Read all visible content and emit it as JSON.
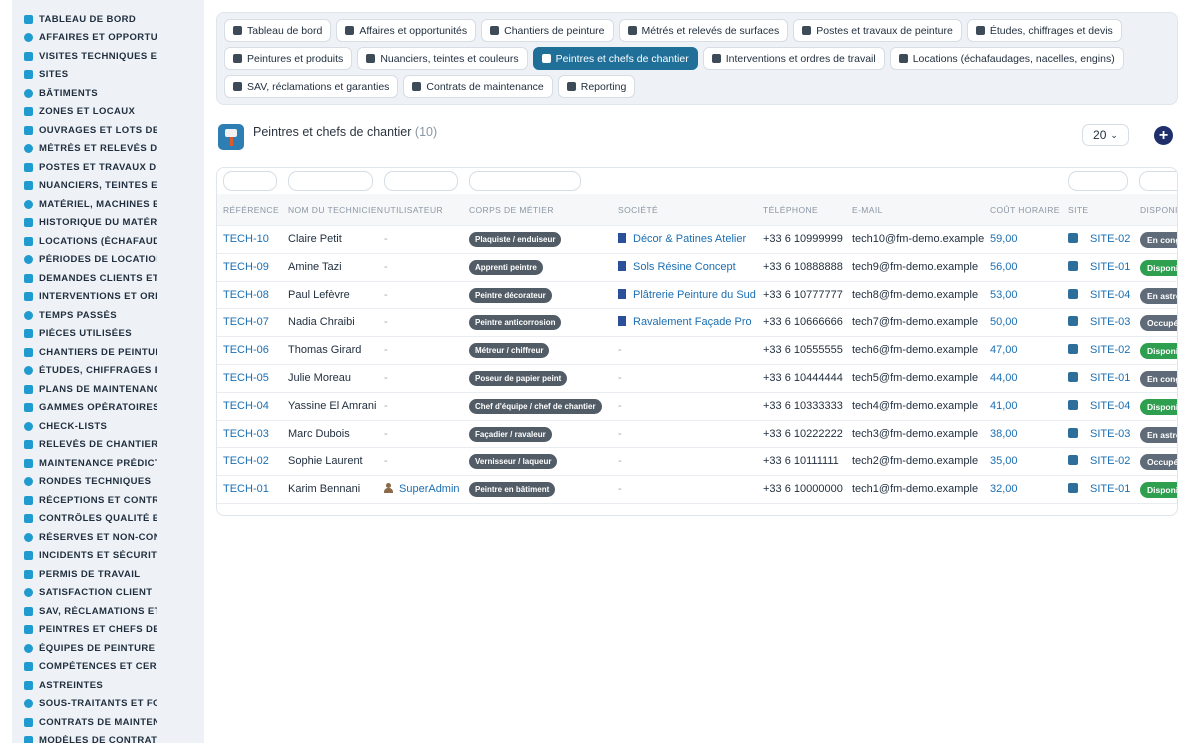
{
  "sidebar": {
    "items": [
      {
        "label": "TABLEAU DE BORD",
        "icon": "dashboard-icon"
      },
      {
        "label": "AFFAIRES ET OPPORTUNITÉS",
        "icon": "target-icon"
      },
      {
        "label": "VISITES TECHNIQUES ET AUDITS",
        "icon": "clipboard-icon"
      },
      {
        "label": "SITES",
        "icon": "location-pin-icon"
      },
      {
        "label": "BÂTIMENTS",
        "icon": "building-icon"
      },
      {
        "label": "ZONES ET LOCAUX",
        "icon": "map-icon"
      },
      {
        "label": "OUVRAGES ET LOTS DE TRAVAUX",
        "icon": "sitemap-icon"
      },
      {
        "label": "MÉTRÉS ET RELEVÉS DE SURFACES",
        "icon": "ruler-icon"
      },
      {
        "label": "POSTES ET TRAVAUX DE PEINTURE",
        "icon": "paint-roller-icon"
      },
      {
        "label": "NUANCIERS, TEINTES ET COULEURS",
        "icon": "palette-icon"
      },
      {
        "label": "MATÉRIEL, MACHINES ET OUTILLAGE",
        "icon": "tools-icon"
      },
      {
        "label": "HISTORIQUE DU MATÉRIEL",
        "icon": "history-icon"
      },
      {
        "label": "LOCATIONS (ÉCHAFAUDAGES)",
        "icon": "truck-icon"
      },
      {
        "label": "PÉRIODES DE LOCATION",
        "icon": "calendar-icon"
      },
      {
        "label": "DEMANDES CLIENTS ET INTERVENTIONS",
        "icon": "inbox-icon"
      },
      {
        "label": "INTERVENTIONS ET ORDRES DE TRAVAIL",
        "icon": "clipboard-check-icon"
      },
      {
        "label": "TEMPS PASSÉS",
        "icon": "clock-icon"
      },
      {
        "label": "PIÈCES UTILISÉES",
        "icon": "box-icon"
      },
      {
        "label": "CHANTIERS DE PEINTURE",
        "icon": "brush-icon"
      },
      {
        "label": "ÉTUDES, CHIFFRAGES ET DEVIS",
        "icon": "calculator-icon"
      },
      {
        "label": "PLANS DE MAINTENANCE",
        "icon": "calendar-check-icon"
      },
      {
        "label": "GAMMES OPÉRATOIRES",
        "icon": "list-icon"
      },
      {
        "label": "CHECK-LISTS",
        "icon": "checklist-icon"
      },
      {
        "label": "RELEVÉS DE CHANTIER",
        "icon": "file-icon"
      },
      {
        "label": "MAINTENANCE PRÉDICTIVE",
        "icon": "chart-line-icon"
      },
      {
        "label": "RONDES TECHNIQUES",
        "icon": "route-icon"
      },
      {
        "label": "RÉCEPTIONS ET CONTRÔLES",
        "icon": "search-icon"
      },
      {
        "label": "CONTRÔLES QUALITÉ ET CONFORMITÉ",
        "icon": "shield-check-icon"
      },
      {
        "label": "RÉSERVES ET NON-CONFORMITÉS",
        "icon": "alert-circle-icon"
      },
      {
        "label": "INCIDENTS ET SÉCURITÉ",
        "icon": "warning-icon"
      },
      {
        "label": "PERMIS DE TRAVAIL",
        "icon": "document-sign-icon"
      },
      {
        "label": "SATISFACTION CLIENT",
        "icon": "smile-icon"
      },
      {
        "label": "SAV, RÉCLAMATIONS ET GARANTIES",
        "icon": "chat-icon"
      },
      {
        "label": "PEINTRES ET CHEFS DE CHANTIER",
        "icon": "hard-hat-icon"
      },
      {
        "label": "ÉQUIPES DE PEINTURE",
        "icon": "users-icon"
      },
      {
        "label": "COMPÉTENCES ET CERTIFICATIONS",
        "icon": "badge-icon"
      },
      {
        "label": "ASTREINTES",
        "icon": "phone-icon"
      },
      {
        "label": "SOUS-TRAITANTS ET FOURNISSEURS",
        "icon": "handshake-icon"
      },
      {
        "label": "CONTRATS DE MAINTENANCE",
        "icon": "contract-icon"
      },
      {
        "label": "MODÈLES DE CONTRATS",
        "icon": "template-icon"
      }
    ]
  },
  "modules": {
    "rows": [
      [
        {
          "label": "Tableau de bord",
          "icon": "dashboard-icon",
          "active": false
        },
        {
          "label": "Affaires et opportunités",
          "icon": "target-icon",
          "active": false
        },
        {
          "label": "Chantiers de peinture",
          "icon": "brush-icon",
          "active": false
        },
        {
          "label": "Métrés et relevés de surfaces",
          "icon": "ruler-icon",
          "active": false
        },
        {
          "label": "Postes et travaux de peinture",
          "icon": "paint-roller-icon",
          "active": false
        },
        {
          "label": "Études, chiffrages et devis",
          "icon": "calculator-icon",
          "active": false
        }
      ],
      [
        {
          "label": "Peintures et produits",
          "icon": "paint-bucket-icon",
          "active": false
        },
        {
          "label": "Nuanciers, teintes et couleurs",
          "icon": "palette-icon",
          "active": false
        },
        {
          "label": "Peintres et chefs de chantier",
          "icon": "hard-hat-icon",
          "active": true
        },
        {
          "label": "Interventions et ordres de travail",
          "icon": "clipboard-check-icon",
          "active": false
        },
        {
          "label": "Locations (échafaudages, nacelles, engins)",
          "icon": "truck-icon",
          "active": false
        }
      ],
      [
        {
          "label": "SAV, réclamations et garanties",
          "icon": "chat-icon",
          "active": false
        },
        {
          "label": "Contrats de maintenance",
          "icon": "contract-icon",
          "active": false
        },
        {
          "label": "Reporting",
          "icon": "pie-chart-icon",
          "active": false
        }
      ]
    ]
  },
  "page": {
    "title": "Peintres et chefs de chantier",
    "count": "(10)",
    "per_page": "20",
    "add_label": "+"
  },
  "table": {
    "headers": [
      "RÉFÉRENCE",
      "NOM DU TECHNICIEN",
      "UTILISATEUR",
      "CORPS DE MÉTIER",
      "SOCIÉTÉ",
      "TÉLÉPHONE",
      "E-MAIL",
      "COÛT HORAIRE",
      "SITE",
      "DISPONIBILITÉ"
    ],
    "rows": [
      {
        "ref": "TECH-10",
        "name": "Claire Petit",
        "user": "-",
        "trade": "Plaquiste / enduiseur",
        "company": "Décor & Patines Atelier",
        "phone": "+33 6 10999999",
        "email": "tech10@fm-demo.example",
        "rate": "59,00",
        "site": "SITE-02",
        "status": "En congé",
        "status_color": "#5f6b78"
      },
      {
        "ref": "TECH-09",
        "name": "Amine Tazi",
        "user": "-",
        "trade": "Apprenti peintre",
        "company": "Sols Résine Concept",
        "phone": "+33 6 10888888",
        "email": "tech9@fm-demo.example",
        "rate": "56,00",
        "site": "SITE-01",
        "status": "Disponible",
        "status_color": "#2e9e4f"
      },
      {
        "ref": "TECH-08",
        "name": "Paul Lefèvre",
        "user": "-",
        "trade": "Peintre décorateur",
        "company": "Plâtrerie Peinture du Sud",
        "phone": "+33 6 10777777",
        "email": "tech8@fm-demo.example",
        "rate": "53,00",
        "site": "SITE-04",
        "status": "En astreinte",
        "status_color": "#5f6b78"
      },
      {
        "ref": "TECH-07",
        "name": "Nadia Chraibi",
        "user": "-",
        "trade": "Peintre anticorrosion",
        "company": "Ravalement Façade Pro",
        "phone": "+33 6 10666666",
        "email": "tech7@fm-demo.example",
        "rate": "50,00",
        "site": "SITE-03",
        "status": "Occupé",
        "status_color": "#5f6b78"
      },
      {
        "ref": "TECH-06",
        "name": "Thomas Girard",
        "user": "-",
        "trade": "Métreur / chiffreur",
        "company": "-",
        "phone": "+33 6 10555555",
        "email": "tech6@fm-demo.example",
        "rate": "47,00",
        "site": "SITE-02",
        "status": "Disponible",
        "status_color": "#2e9e4f"
      },
      {
        "ref": "TECH-05",
        "name": "Julie Moreau",
        "user": "-",
        "trade": "Poseur de papier peint",
        "company": "-",
        "phone": "+33 6 10444444",
        "email": "tech5@fm-demo.example",
        "rate": "44,00",
        "site": "SITE-01",
        "status": "En congé",
        "status_color": "#5f6b78"
      },
      {
        "ref": "TECH-04",
        "name": "Yassine El Amrani",
        "user": "-",
        "trade": "Chef d'équipe / chef de chantier",
        "company": "-",
        "phone": "+33 6 10333333",
        "email": "tech4@fm-demo.example",
        "rate": "41,00",
        "site": "SITE-04",
        "status": "Disponible",
        "status_color": "#2e9e4f"
      },
      {
        "ref": "TECH-03",
        "name": "Marc Dubois",
        "user": "-",
        "trade": "Façadier / ravaleur",
        "company": "-",
        "phone": "+33 6 10222222",
        "email": "tech3@fm-demo.example",
        "rate": "38,00",
        "site": "SITE-03",
        "status": "En astreinte",
        "status_color": "#5f6b78"
      },
      {
        "ref": "TECH-02",
        "name": "Sophie Laurent",
        "user": "-",
        "trade": "Vernisseur / laqueur",
        "company": "-",
        "phone": "+33 6 10111111",
        "email": "tech2@fm-demo.example",
        "rate": "35,00",
        "site": "SITE-02",
        "status": "Occupé",
        "status_color": "#5f6b78"
      },
      {
        "ref": "TECH-01",
        "name": "Karim Bennani",
        "user": "SuperAdmin",
        "trade": "Peintre en bâtiment",
        "company": "-",
        "phone": "+33 6 10000000",
        "email": "tech1@fm-demo.example",
        "rate": "32,00",
        "site": "SITE-01",
        "status": "Disponible",
        "status_color": "#2e9e4f"
      }
    ]
  },
  "colors": {
    "accent": "#1f6f99",
    "link": "#1b6fb3",
    "sidebar_icon": "#1f9bcf",
    "add_button": "#1e2f6b",
    "status_available": "#2e9e4f",
    "status_other": "#5f6b78"
  }
}
